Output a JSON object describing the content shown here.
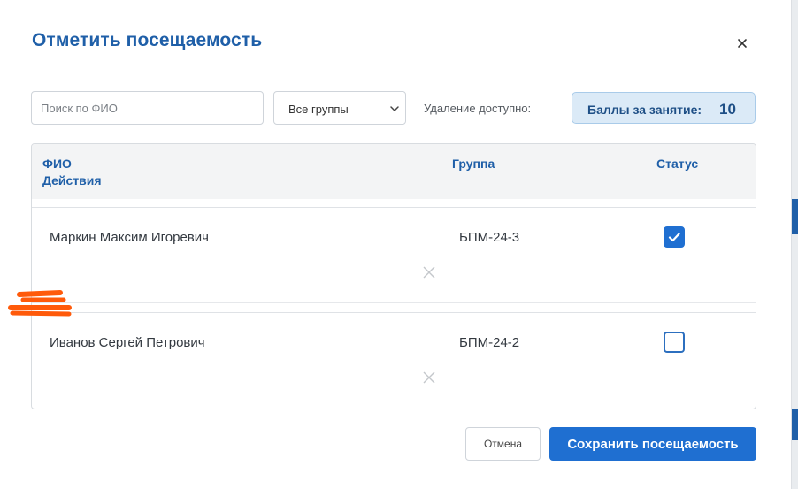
{
  "modal": {
    "title": "Отметить посещаемость",
    "close_icon": "close-icon"
  },
  "controls": {
    "search_placeholder": "Поиск по ФИО",
    "search_value": "",
    "group_filter_selected": "Все группы",
    "delete_available_label": "Удаление доступно:",
    "points_label": "Баллы за занятие:",
    "points_value": "10"
  },
  "table": {
    "header": {
      "name_column": "ФИО",
      "actions_column": "Действия",
      "group_column": "Группа",
      "status_column": "Статус"
    },
    "rows": [
      {
        "name": "Маркин Максим Игоревич",
        "group": "БПМ-24-3",
        "present": true
      },
      {
        "name": "Иванов Сергей Петрович",
        "group": "БПМ-24-2",
        "present": false
      }
    ]
  },
  "footer": {
    "cancel_label": "Отмена",
    "save_label": "Сохранить посещаемость"
  },
  "colors": {
    "accent": "#1f6fd1",
    "title": "#1f5fa8",
    "badge_bg": "#dbeaf7",
    "annotation": "#ff5a0a"
  }
}
